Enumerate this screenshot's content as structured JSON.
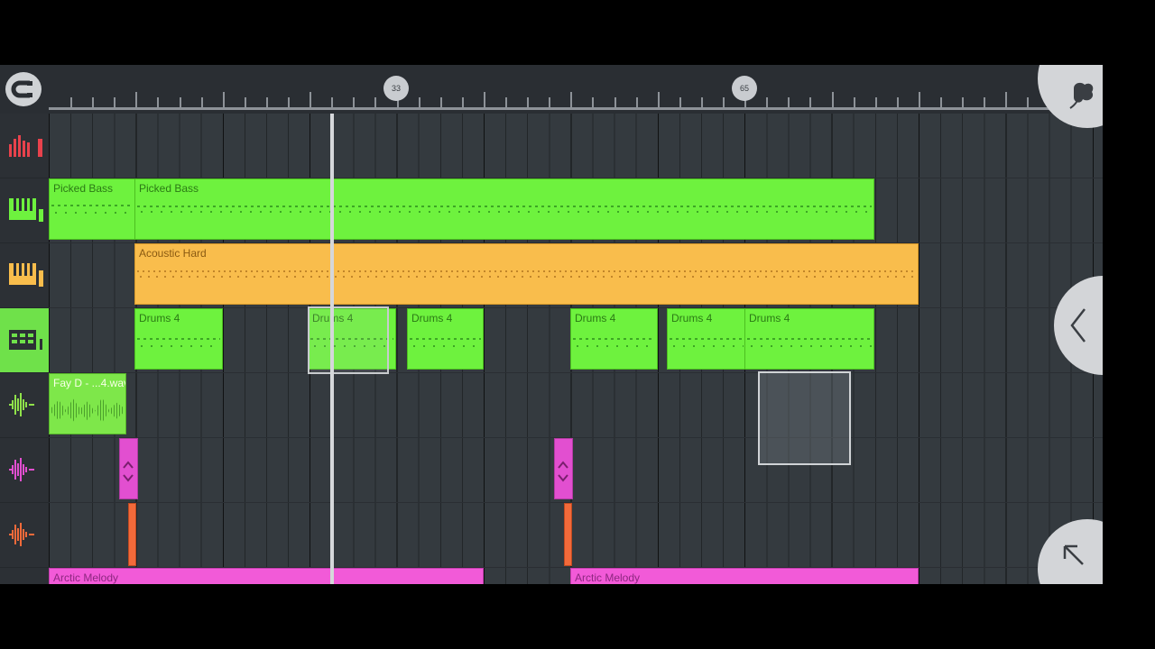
{
  "ruler": {
    "magnet_icon": "magnet-icon",
    "markers": [
      "33",
      "65"
    ]
  },
  "tracks": [
    {
      "icon": "automation-bars-icon",
      "color": "#e8424c"
    },
    {
      "icon": "piano-keys-icon",
      "color": "#6ef23e"
    },
    {
      "icon": "piano-keys-icon",
      "color": "#f9bd4c"
    },
    {
      "icon": "drum-pads-icon",
      "color": "#6fe14a",
      "active": true
    },
    {
      "icon": "audio-wave-icon",
      "color": "#8fe14a"
    },
    {
      "icon": "audio-wave-icon",
      "color": "#e24fd0"
    },
    {
      "icon": "audio-wave-icon",
      "color": "#f36a3a"
    }
  ],
  "clips": {
    "picked_bass_1": "Picked Bass",
    "picked_bass_2": "Picked Bass",
    "acoustic_hard": "Acoustic Hard",
    "drums_1": "Drums 4",
    "drums_2": "Drums 4",
    "drums_3": "Drums 4",
    "drums_4": "Drums 4",
    "drums_5": "Drums 4",
    "drums_6": "Drums 4",
    "audio_clip": "Fay D - ...4.wav",
    "arctic_1": "Arctic Melody",
    "arctic_2": "Arctic Melody"
  },
  "buttons": {
    "logo": "fl-studio-logo",
    "collapse": "chevron-left-icon",
    "expand": "arrow-up-left-icon"
  },
  "colors": {
    "green": "#6ef23e",
    "orange": "#f9bd4c",
    "pink": "#f25ad8",
    "magenta_pulse": "#e24fd0",
    "orange_pulse": "#f36a3a"
  }
}
